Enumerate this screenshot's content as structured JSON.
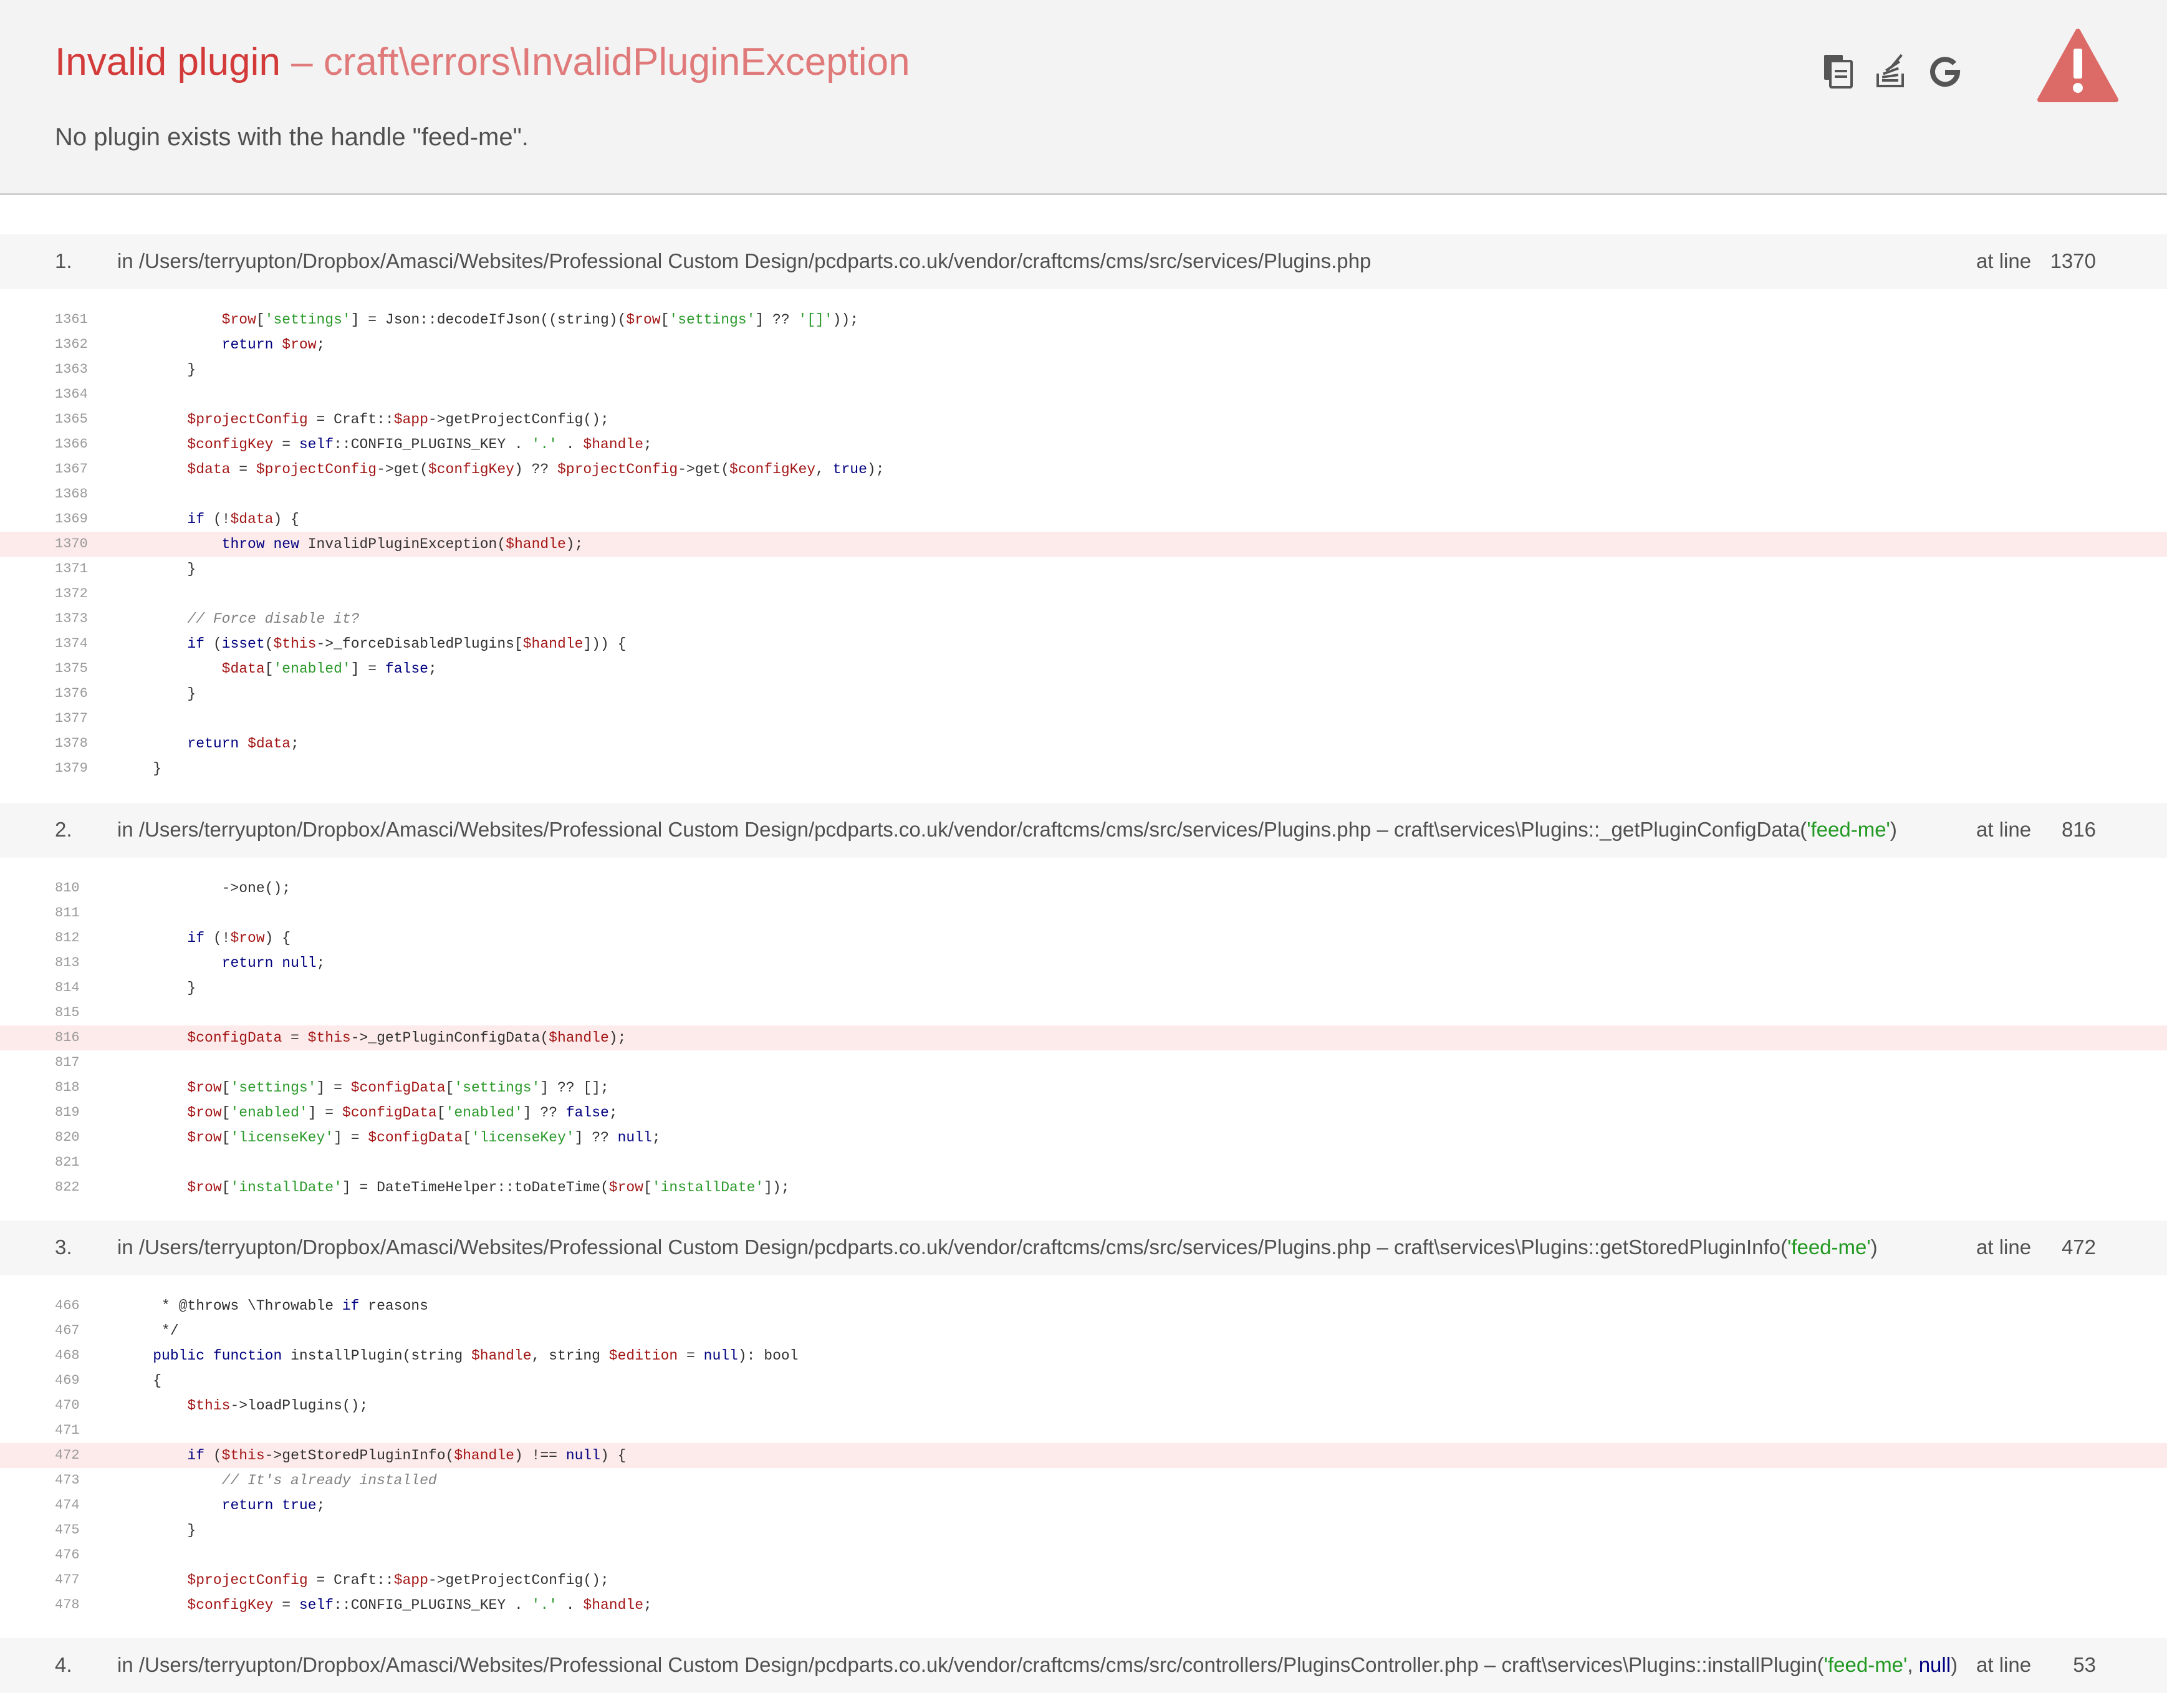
{
  "header": {
    "title_name": "Invalid plugin",
    "title_dash": " – ",
    "title_class": "craft\\errors\\InvalidPluginException",
    "message": "No plugin exists with the handle \"feed-me\".",
    "tools": [
      "copy-icon",
      "stackoverflow-icon",
      "google-icon"
    ],
    "warning_icon": "warning-triangle-icon",
    "colors": {
      "title": "#d33a3a",
      "warning": "#d9534f"
    }
  },
  "frames": [
    {
      "number": "1.",
      "path": "in /Users/terryupton/Dropbox/Amasci/Websites/Professional Custom Design/pcdparts.co.uk/vendor/craftcms/cms/src/services/Plugins.php",
      "call": "",
      "args": [],
      "at_label": "at line",
      "line": "1370",
      "highlight": "1370",
      "lines": [
        {
          "n": "1361",
          "t": "            $row['settings'] = Json::decodeIfJson((string)($row['settings'] ?? '[]'));"
        },
        {
          "n": "1362",
          "t": "            return $row;"
        },
        {
          "n": "1363",
          "t": "        }"
        },
        {
          "n": "1364",
          "t": ""
        },
        {
          "n": "1365",
          "t": "        $projectConfig = Craft::$app->getProjectConfig();"
        },
        {
          "n": "1366",
          "t": "        $configKey = self::CONFIG_PLUGINS_KEY . '.' . $handle;"
        },
        {
          "n": "1367",
          "t": "        $data = $projectConfig->get($configKey) ?? $projectConfig->get($configKey, true);"
        },
        {
          "n": "1368",
          "t": ""
        },
        {
          "n": "1369",
          "t": "        if (!$data) {"
        },
        {
          "n": "1370",
          "t": "            throw new InvalidPluginException($handle);"
        },
        {
          "n": "1371",
          "t": "        }"
        },
        {
          "n": "1372",
          "t": ""
        },
        {
          "n": "1373",
          "t": "        // Force disable it?"
        },
        {
          "n": "1374",
          "t": "        if (isset($this->_forceDisabledPlugins[$handle])) {"
        },
        {
          "n": "1375",
          "t": "            $data['enabled'] = false;"
        },
        {
          "n": "1376",
          "t": "        }"
        },
        {
          "n": "1377",
          "t": ""
        },
        {
          "n": "1378",
          "t": "        return $data;"
        },
        {
          "n": "1379",
          "t": "    }"
        }
      ]
    },
    {
      "number": "2.",
      "path": "in /Users/terryupton/Dropbox/Amasci/Websites/Professional Custom Design/pcdparts.co.uk/vendor/craftcms/cms/src/services/Plugins.php",
      "call": " – craft\\services\\Plugins::_getPluginConfigData(",
      "args": [
        {
          "text": "'feed-me'",
          "kind": "str"
        }
      ],
      "at_label": "at line",
      "line": "816",
      "highlight": "816",
      "lines": [
        {
          "n": "810",
          "t": "            ->one();"
        },
        {
          "n": "811",
          "t": ""
        },
        {
          "n": "812",
          "t": "        if (!$row) {"
        },
        {
          "n": "813",
          "t": "            return null;"
        },
        {
          "n": "814",
          "t": "        }"
        },
        {
          "n": "815",
          "t": ""
        },
        {
          "n": "816",
          "t": "        $configData = $this->_getPluginConfigData($handle);"
        },
        {
          "n": "817",
          "t": ""
        },
        {
          "n": "818",
          "t": "        $row['settings'] = $configData['settings'] ?? [];"
        },
        {
          "n": "819",
          "t": "        $row['enabled'] = $configData['enabled'] ?? false;"
        },
        {
          "n": "820",
          "t": "        $row['licenseKey'] = $configData['licenseKey'] ?? null;"
        },
        {
          "n": "821",
          "t": ""
        },
        {
          "n": "822",
          "t": "        $row['installDate'] = DateTimeHelper::toDateTime($row['installDate']);"
        }
      ]
    },
    {
      "number": "3.",
      "path": "in /Users/terryupton/Dropbox/Amasci/Websites/Professional Custom Design/pcdparts.co.uk/vendor/craftcms/cms/src/services/Plugins.php",
      "call": " – craft\\services\\Plugins::getStoredPluginInfo(",
      "args": [
        {
          "text": "'feed-me'",
          "kind": "str"
        }
      ],
      "at_label": "at line",
      "line": "472",
      "highlight": "472",
      "lines": [
        {
          "n": "466",
          "t": "     * @throws \\Throwable if reasons"
        },
        {
          "n": "467",
          "t": "     */"
        },
        {
          "n": "468",
          "t": "    public function installPlugin(string $handle, string $edition = null): bool"
        },
        {
          "n": "469",
          "t": "    {"
        },
        {
          "n": "470",
          "t": "        $this->loadPlugins();"
        },
        {
          "n": "471",
          "t": ""
        },
        {
          "n": "472",
          "t": "        if ($this->getStoredPluginInfo($handle) !== null) {"
        },
        {
          "n": "473",
          "t": "            // It's already installed"
        },
        {
          "n": "474",
          "t": "            return true;"
        },
        {
          "n": "475",
          "t": "        }"
        },
        {
          "n": "476",
          "t": ""
        },
        {
          "n": "477",
          "t": "        $projectConfig = Craft::$app->getProjectConfig();"
        },
        {
          "n": "478",
          "t": "        $configKey = self::CONFIG_PLUGINS_KEY . '.' . $handle;"
        }
      ]
    },
    {
      "number": "4.",
      "path": "in /Users/terryupton/Dropbox/Amasci/Websites/Professional Custom Design/pcdparts.co.uk/vendor/craftcms/cms/src/controllers/PluginsController.php",
      "call": " – craft\\services\\Plugins::installPlugin(",
      "args": [
        {
          "text": "'feed-me'",
          "kind": "str"
        },
        {
          "text": "null",
          "kind": "kw"
        }
      ],
      "at_label": "at line",
      "line": "53",
      "highlight": "",
      "lines": []
    }
  ]
}
